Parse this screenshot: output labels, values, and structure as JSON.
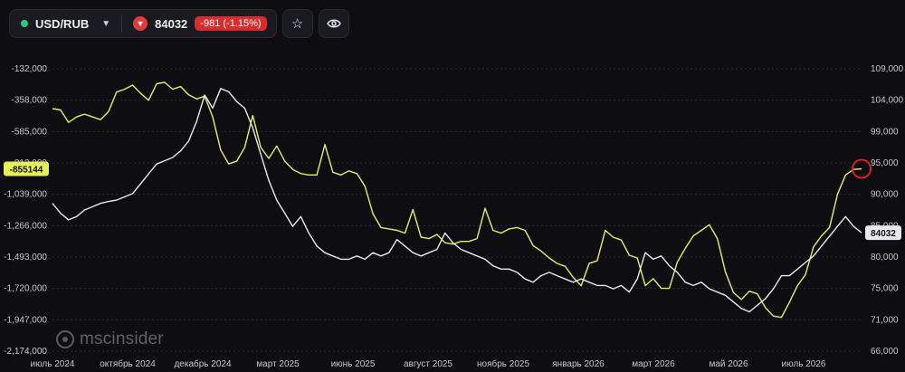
{
  "toolbar": {
    "pair": "USD/RUB",
    "price": "84032",
    "change": "-981 (-1.15%)",
    "status_color": "#2ecc71",
    "change_color": "#d52e2e",
    "favorite_icon": "star-icon",
    "watch_icon": "eye-icon"
  },
  "watermark": {
    "text": "mscinsider"
  },
  "chart_data": {
    "type": "line",
    "x_ticks": [
      "июль 2024",
      "октябрь 2024",
      "декабрь 2024",
      "март 2025",
      "июнь 2025",
      "август 2025",
      "ноябрь 2025",
      "январь 2026",
      "март 2026",
      "май 2026",
      "июль 2026"
    ],
    "left_axis": {
      "ticks": [
        "-132,000",
        "-358,000",
        "-585,000",
        "-812,000",
        "-1,039,000",
        "-1,266,000",
        "-1,493,000",
        "-1,720,000",
        "-1,947,000",
        "-2,174,000"
      ],
      "ylim": [
        -2174000,
        -132000
      ]
    },
    "right_axis": {
      "ticks": [
        "109,000",
        "104,000",
        "99,000",
        "95,000",
        "90,000",
        "85,000",
        "80,000",
        "75,000",
        "71,000",
        "66,000"
      ],
      "ylim": [
        66000,
        109000
      ]
    },
    "current_left_label": "-855144",
    "current_right_label": "84032",
    "series": [
      {
        "axis": "left",
        "color": "#e6f05a",
        "values": [
          -420000,
          -430000,
          -520000,
          -480000,
          -460000,
          -480000,
          -500000,
          -440000,
          -300000,
          -280000,
          -250000,
          -310000,
          -360000,
          -240000,
          -230000,
          -280000,
          -260000,
          -320000,
          -350000,
          -330000,
          -480000,
          -720000,
          -820000,
          -800000,
          -700000,
          -470000,
          -700000,
          -780000,
          -690000,
          -800000,
          -860000,
          -890000,
          -900000,
          -900000,
          -680000,
          -880000,
          -900000,
          -870000,
          -890000,
          -980000,
          -1180000,
          -1280000,
          -1290000,
          -1300000,
          -1320000,
          -1150000,
          -1350000,
          -1360000,
          -1330000,
          -1390000,
          -1400000,
          -1380000,
          -1380000,
          -1360000,
          -1140000,
          -1300000,
          -1320000,
          -1290000,
          -1280000,
          -1300000,
          -1410000,
          -1450000,
          -1500000,
          -1540000,
          -1560000,
          -1640000,
          -1700000,
          -1540000,
          -1520000,
          -1300000,
          -1350000,
          -1370000,
          -1480000,
          -1500000,
          -1700000,
          -1650000,
          -1720000,
          -1720000,
          -1530000,
          -1430000,
          -1340000,
          -1300000,
          -1260000,
          -1360000,
          -1600000,
          -1750000,
          -1800000,
          -1740000,
          -1760000,
          -1860000,
          -1920000,
          -1930000,
          -1820000,
          -1700000,
          -1620000,
          -1420000,
          -1340000,
          -1280000,
          -1040000,
          -900000,
          -860000,
          -855144
        ]
      },
      {
        "axis": "right",
        "color": "#e8e8ee",
        "values": [
          88500,
          87000,
          86000,
          86500,
          87500,
          88000,
          88500,
          88800,
          89000,
          89500,
          90000,
          91500,
          93000,
          94500,
          95000,
          95500,
          96500,
          98000,
          101000,
          105000,
          103000,
          106000,
          105500,
          104000,
          103000,
          100000,
          96000,
          92000,
          89000,
          87000,
          85000,
          86500,
          84000,
          82000,
          81000,
          80500,
          80000,
          80000,
          80500,
          80000,
          81000,
          80500,
          81000,
          83000,
          82000,
          81000,
          80500,
          81000,
          81500,
          84000,
          82500,
          81500,
          81000,
          80500,
          80000,
          79000,
          78500,
          78500,
          78000,
          77000,
          76500,
          77500,
          78000,
          77500,
          77000,
          76500,
          77000,
          76500,
          76000,
          76000,
          75500,
          76000,
          75000,
          77000,
          81000,
          80000,
          80500,
          79000,
          78000,
          76500,
          76000,
          76500,
          75500,
          75000,
          74500,
          73500,
          72500,
          72000,
          73000,
          74000,
          75500,
          77500,
          77500,
          78500,
          79500,
          80500,
          82000,
          83500,
          85000,
          86500,
          85000,
          84032
        ]
      }
    ],
    "grid": true,
    "legend": "none"
  }
}
